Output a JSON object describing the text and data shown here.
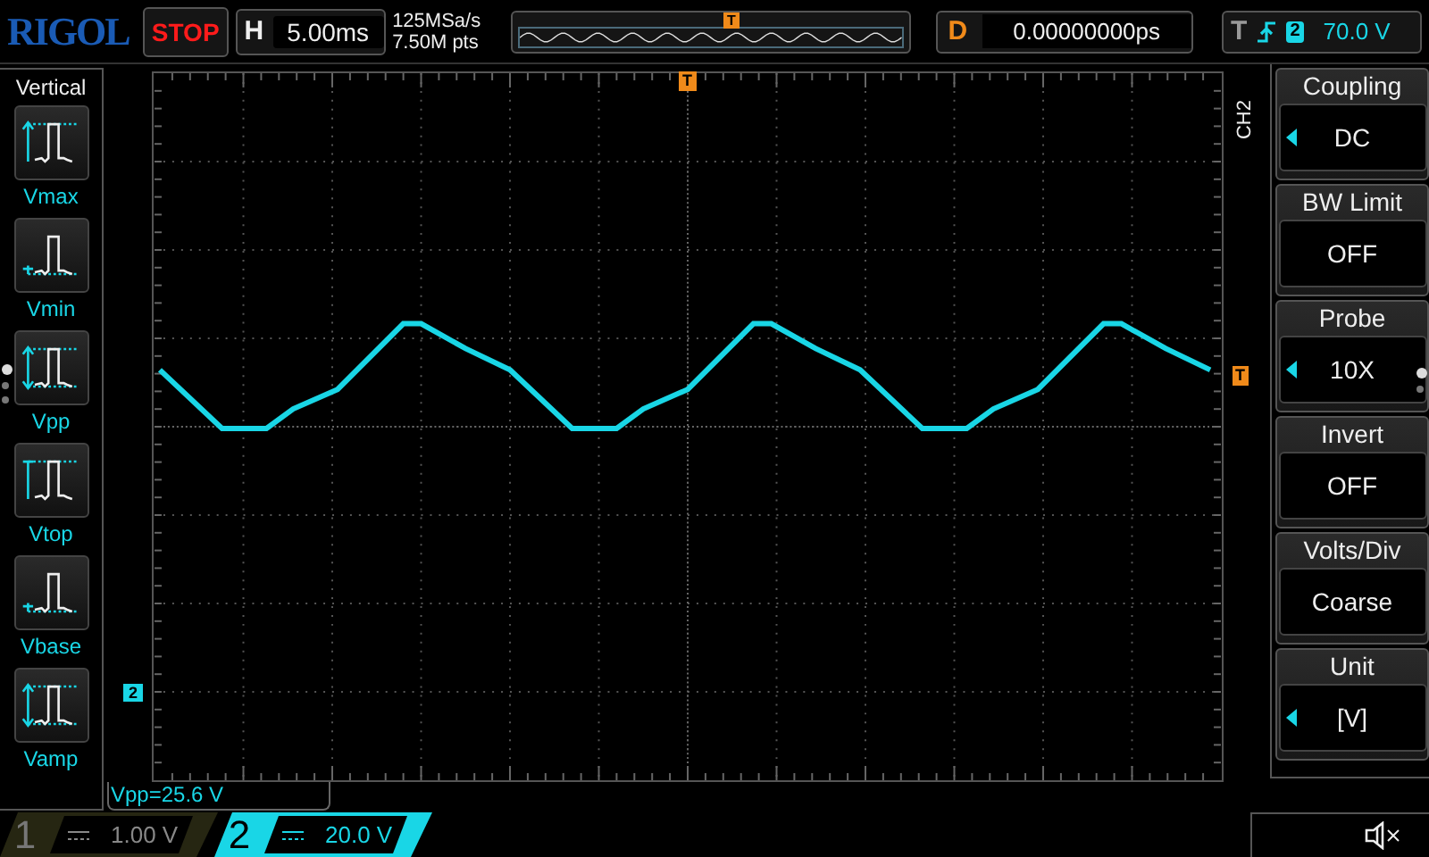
{
  "brand": "RIGOL",
  "run_state": "STOP",
  "horizontal": {
    "label": "H",
    "timebase": "5.00ms"
  },
  "acquisition": {
    "sample_rate": "125MSa/s",
    "memory_depth": "7.50M pts"
  },
  "overview": {
    "trigger_marker": "T"
  },
  "delay": {
    "label": "D",
    "value": "0.00000000ps"
  },
  "trigger": {
    "label": "T",
    "source": "2",
    "level": "70.0 V"
  },
  "left_menu": {
    "title": "Vertical",
    "items": [
      {
        "kind": "vmax",
        "label": "Vmax"
      },
      {
        "kind": "vmin",
        "label": "Vmin"
      },
      {
        "kind": "vpp",
        "label": "Vpp"
      },
      {
        "kind": "vtop",
        "label": "Vtop"
      },
      {
        "kind": "vbase",
        "label": "Vbase"
      },
      {
        "kind": "vamp",
        "label": "Vamp"
      }
    ],
    "pages": [
      {
        "selected": true
      },
      {
        "selected": false
      },
      {
        "selected": false
      }
    ]
  },
  "screen": {
    "trigger_position_marker": "T",
    "trigger_level_marker": "T",
    "channel_marker": "2",
    "measurement": "Vpp=25.6 V"
  },
  "right_menu": {
    "channel": "CH2",
    "items": [
      {
        "title": "Coupling",
        "value": "DC",
        "selectable": true
      },
      {
        "title": "BW Limit",
        "value": "OFF",
        "selectable": false
      },
      {
        "title": "Probe",
        "value": "10X",
        "selectable": true
      },
      {
        "title": "Invert",
        "value": "OFF",
        "selectable": false
      },
      {
        "title": "Volts/Div",
        "value": "Coarse",
        "selectable": false
      },
      {
        "title": "Unit",
        "value": "[V]",
        "selectable": true
      }
    ],
    "pages": [
      {
        "selected": true
      },
      {
        "selected": false
      }
    ]
  },
  "channels": [
    {
      "number": "1",
      "scale": "1.00 V",
      "selected": false
    },
    {
      "number": "2",
      "scale": "20.0 V",
      "selected": true
    }
  ]
}
